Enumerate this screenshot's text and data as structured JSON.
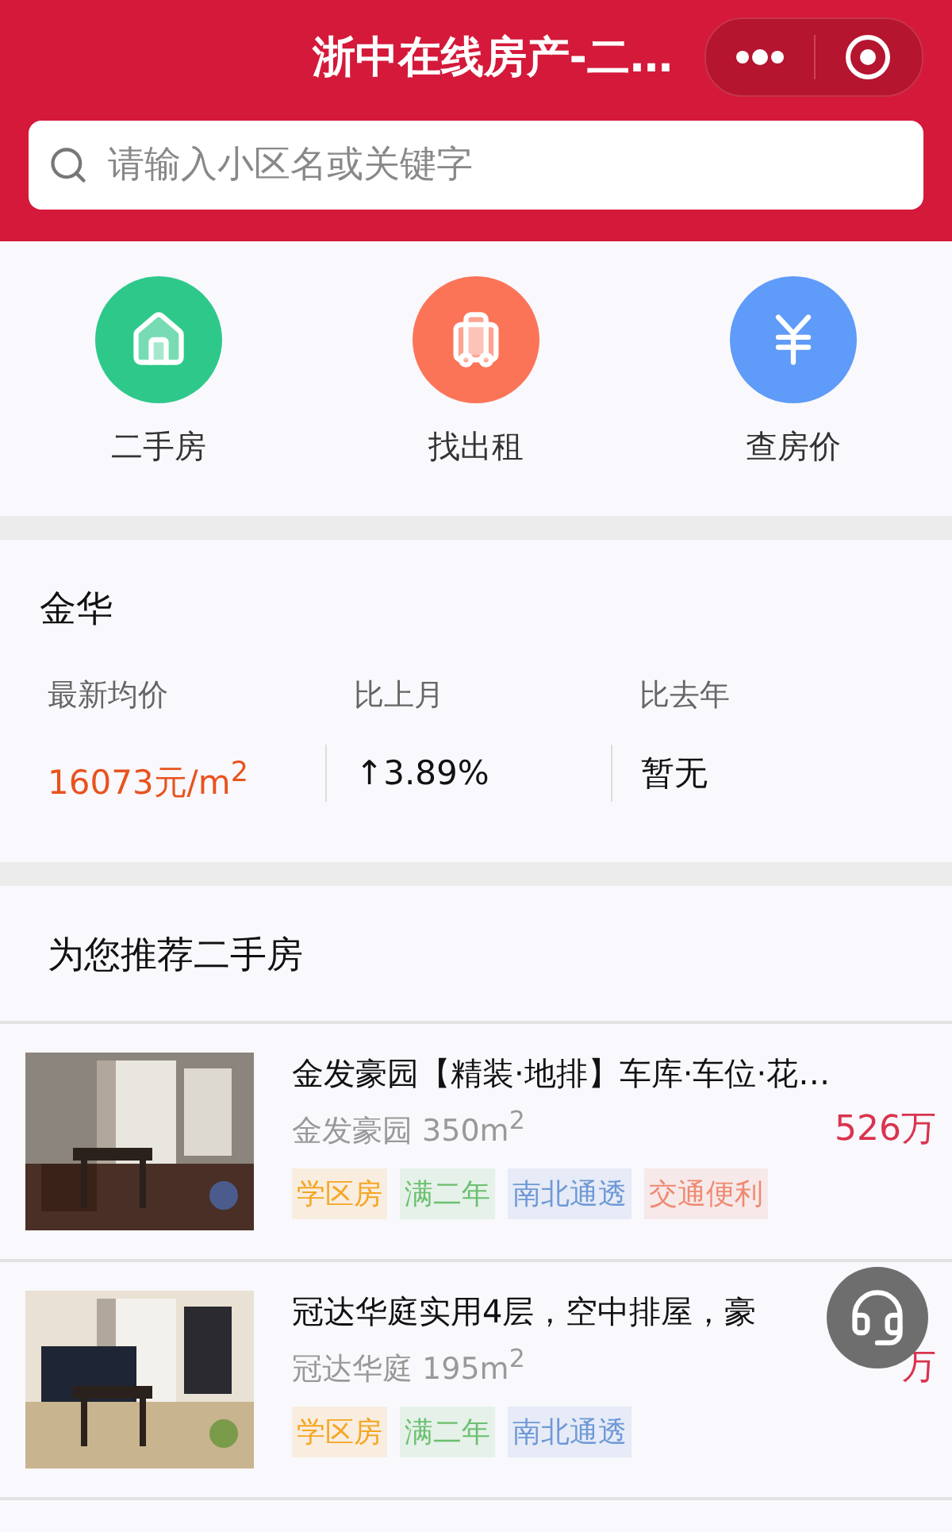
{
  "header": {
    "title": "浙中在线房产-二…",
    "search": {
      "placeholder": "请输入小区名或关键字"
    }
  },
  "nav": [
    {
      "label": "二手房",
      "color": "#2ec98a"
    },
    {
      "label": "找出租",
      "color": "#fb7458"
    },
    {
      "label": "查房价",
      "color": "#5f9bf8"
    }
  ],
  "city": {
    "name": "金华",
    "stats": [
      {
        "label": "最新均价",
        "value": "16073元/m$^{2}$",
        "kind": "price"
      },
      {
        "label": "比上月",
        "value": "↑3.89%",
        "kind": "plain"
      },
      {
        "label": "比去年",
        "value": "暂无",
        "kind": "plain"
      }
    ]
  },
  "recommend": {
    "title": "为您推荐二手房",
    "listings": [
      {
        "title": "金发豪园【精装·地排】车库·车位·花…",
        "subtitle": "金发豪园 350m$^{2}$",
        "price": "526万",
        "tags": [
          {
            "label": "学区房",
            "color": "#f5a623"
          },
          {
            "label": "满二年",
            "color": "#6cc070"
          },
          {
            "label": "南北通透",
            "color": "#6f99d6"
          },
          {
            "label": "交通便利",
            "color": "#ee8a72"
          }
        ]
      },
      {
        "title": "冠达华庭实用4层，空中排屋，豪",
        "subtitle": "冠达华庭 195m$^{2}$",
        "price": "万",
        "tags": [
          {
            "label": "学区房",
            "color": "#f5a623"
          },
          {
            "label": "满二年",
            "color": "#6cc070"
          },
          {
            "label": "南北通透",
            "color": "#6f99d6"
          }
        ]
      }
    ]
  }
}
